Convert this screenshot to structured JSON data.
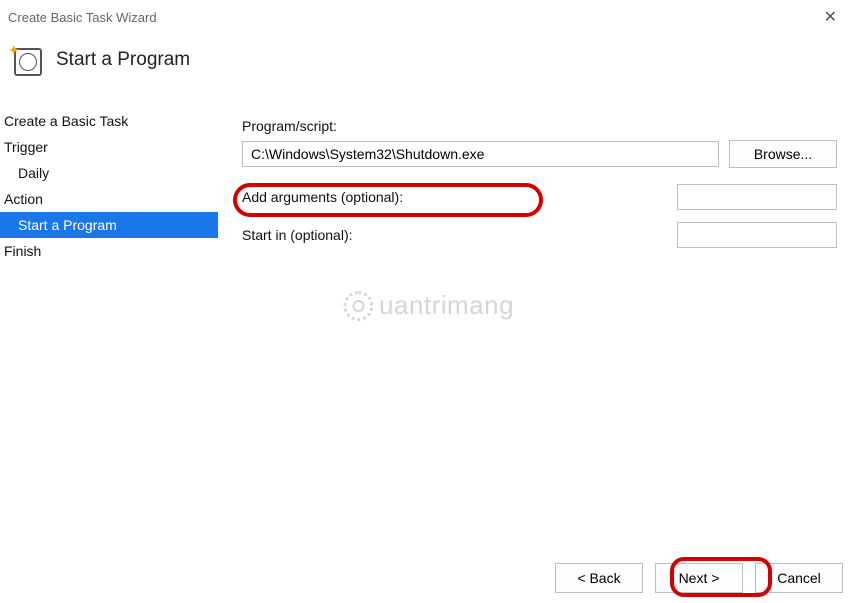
{
  "window": {
    "title": "Create Basic Task Wizard"
  },
  "header": {
    "title": "Start a Program"
  },
  "sidebar": {
    "items": [
      {
        "label": "Create a Basic Task",
        "sub": false,
        "selected": false
      },
      {
        "label": "Trigger",
        "sub": false,
        "selected": false
      },
      {
        "label": "Daily",
        "sub": true,
        "selected": false
      },
      {
        "label": "Action",
        "sub": false,
        "selected": false
      },
      {
        "label": "Start a Program",
        "sub": true,
        "selected": true
      },
      {
        "label": "Finish",
        "sub": false,
        "selected": false
      }
    ]
  },
  "main": {
    "program_label": "Program/script:",
    "program_value": "C:\\Windows\\System32\\Shutdown.exe",
    "browse_label": "Browse...",
    "arguments_label": "Add arguments (optional):",
    "arguments_value": "",
    "startin_label": "Start in (optional):",
    "startin_value": ""
  },
  "footer": {
    "back": "< Back",
    "next": "Next >",
    "cancel": "Cancel"
  },
  "watermark": "uantrimang"
}
